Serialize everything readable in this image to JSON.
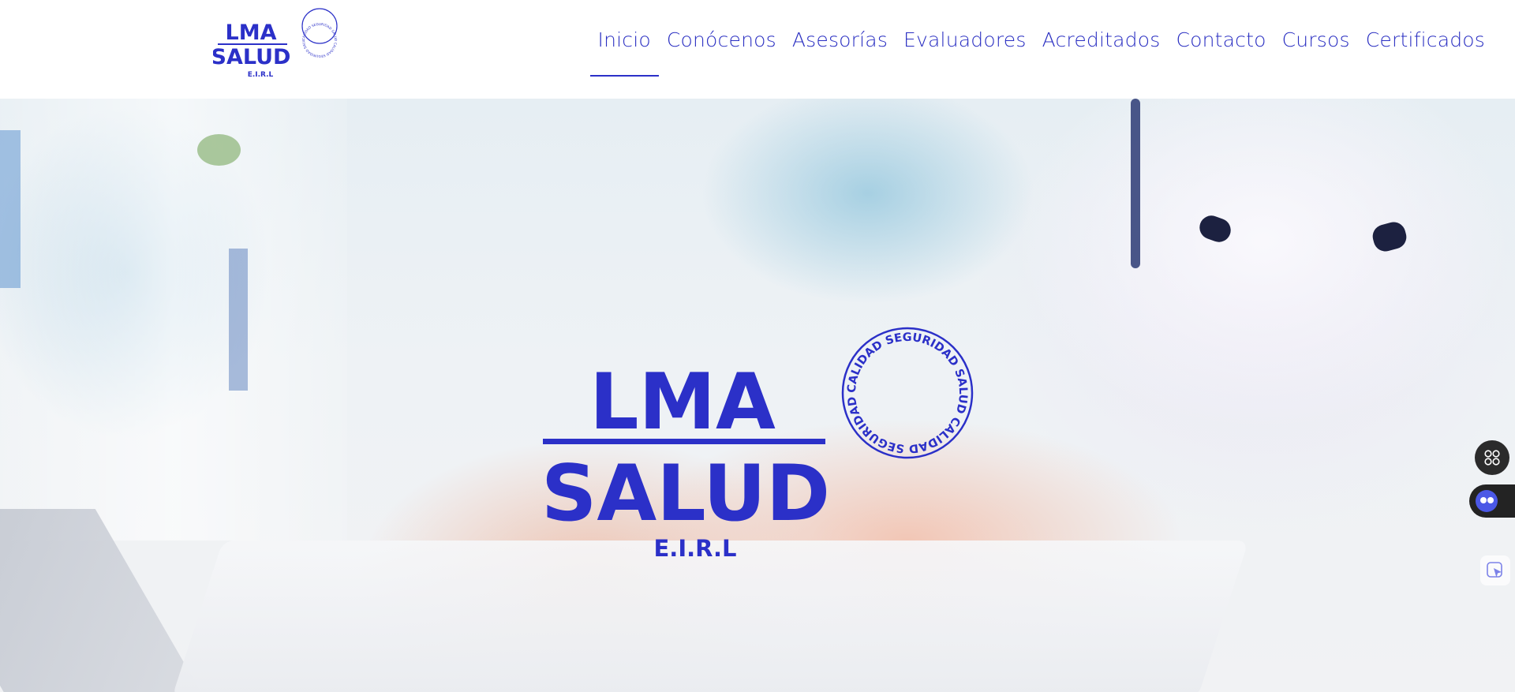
{
  "brand": {
    "line1": "LMA",
    "line2": "SALUD",
    "line3": "E.I.R.L",
    "seal_text": "CALIDAD SEGURIDAD SALUD CALIDAD SEGURIDAD SALUD",
    "color": "#2b30c8"
  },
  "nav": {
    "items": [
      {
        "label": "Inicio",
        "active": true
      },
      {
        "label": "Conócenos",
        "active": false
      },
      {
        "label": "Asesorías",
        "active": false
      },
      {
        "label": "Evaluadores",
        "active": false
      },
      {
        "label": "Acreditados",
        "active": false
      },
      {
        "label": "Contacto",
        "active": false
      },
      {
        "label": "Cursos",
        "active": false
      },
      {
        "label": "Certificados",
        "active": false
      }
    ]
  },
  "widgets": {
    "apps_icon": "apps-grid-icon",
    "chat_icon": "chat-bot-icon",
    "cursor_icon": "cursor-pointer-icon"
  }
}
